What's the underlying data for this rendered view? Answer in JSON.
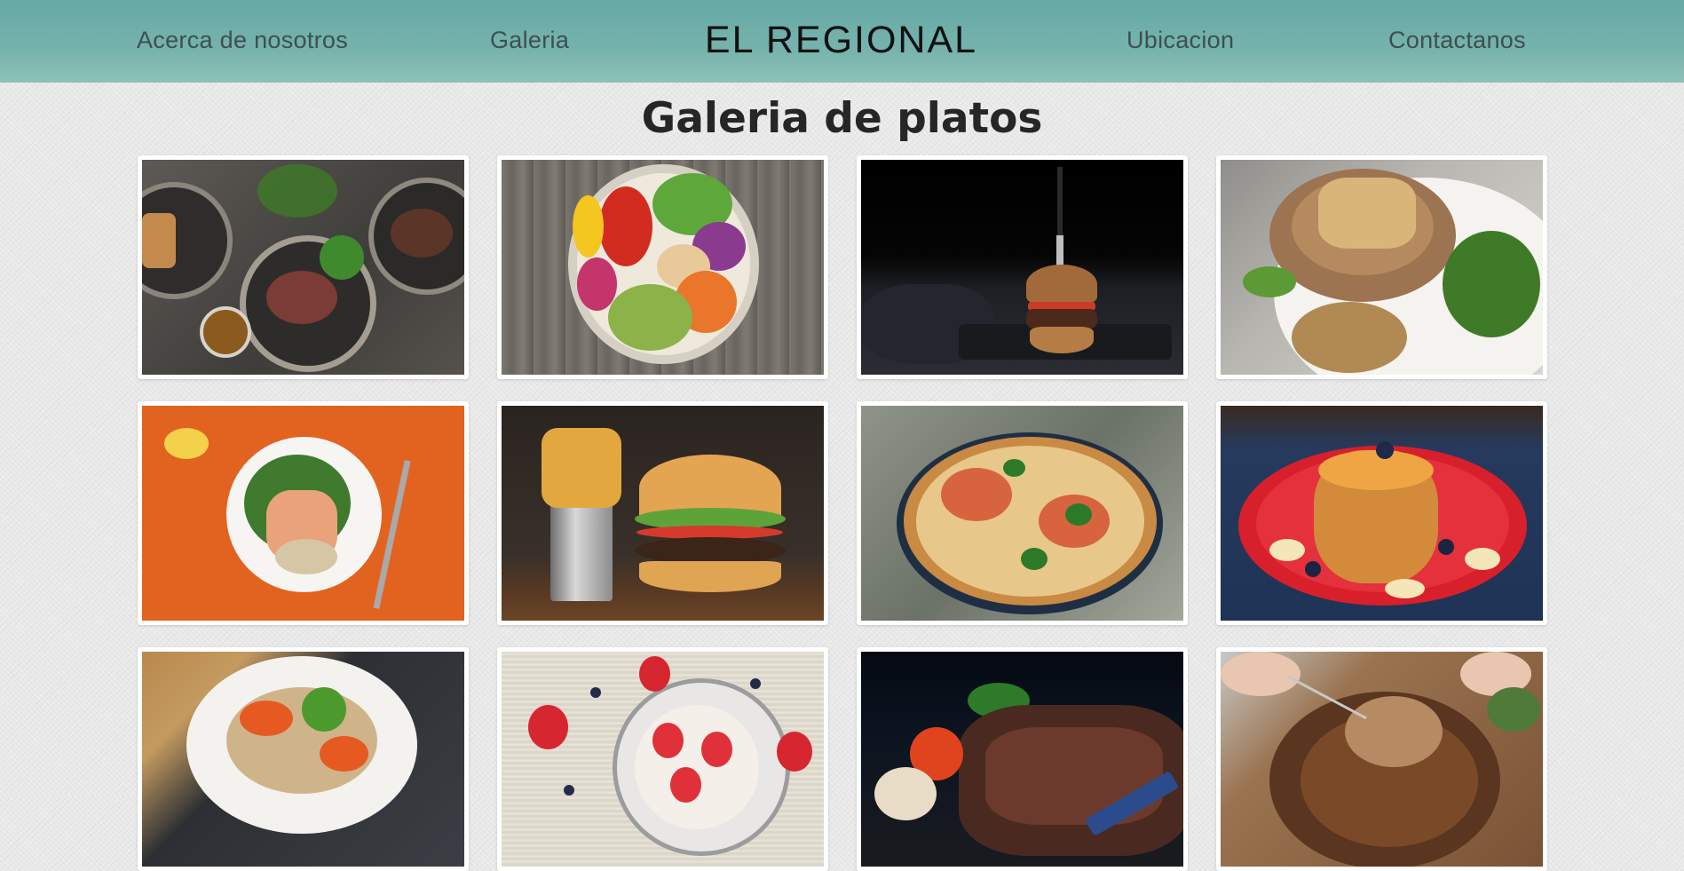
{
  "nav": {
    "about_label": "Acerca de nosotros",
    "gallery_label": "Galeria",
    "brand": "EL REGIONAL",
    "location_label": "Ubicacion",
    "contact_label": "Contactanos"
  },
  "page": {
    "title": "Galeria de platos"
  },
  "colors": {
    "navbar": "#76b3ad",
    "nav_text": "#3e4f4f",
    "card_border": "#ffffff",
    "background": "#e8e8e8"
  },
  "gallery": {
    "photos": [
      {
        "subject": "salmon and steak plates with herbs and cashews"
      },
      {
        "subject": "vegetable bowl with tomatoes, avocado and chickpeas"
      },
      {
        "subject": "burger with knife on dark background"
      },
      {
        "subject": "pork chop with apples and broccolini"
      },
      {
        "subject": "salmon with broccoli on orange background"
      },
      {
        "subject": "burger with fries in metal cup"
      },
      {
        "subject": "margherita pizza"
      },
      {
        "subject": "pancakes with syrup and blueberries"
      },
      {
        "subject": "noodle salad with carrots"
      },
      {
        "subject": "strawberries with yogurt bowl"
      },
      {
        "subject": "grilled steak with vegetables"
      },
      {
        "subject": "carving roast turkey"
      }
    ]
  }
}
